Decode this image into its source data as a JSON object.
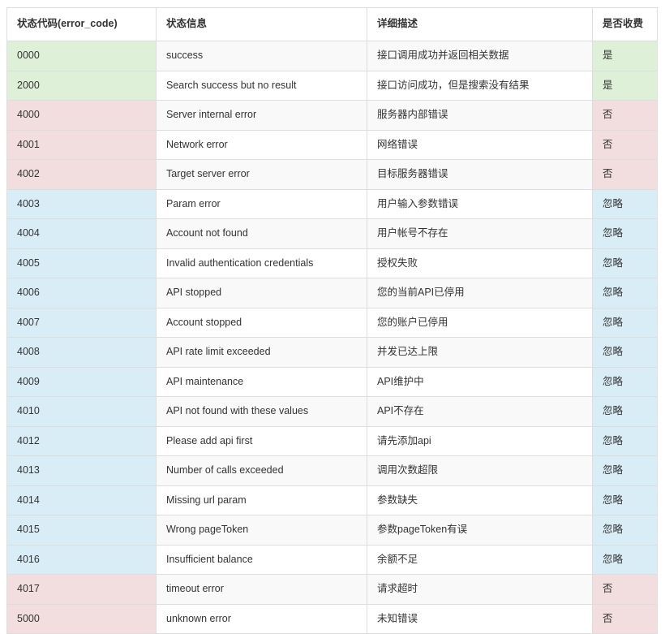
{
  "table": {
    "columns": [
      {
        "key": "code",
        "label": "状态代码(error_code)"
      },
      {
        "key": "msg",
        "label": "状态信息"
      },
      {
        "key": "desc",
        "label": "详细描述"
      },
      {
        "key": "fee",
        "label": "是否收费"
      }
    ],
    "status_colors": {
      "success": "#dff0d8",
      "error": "#f2dede",
      "ignore": "#d9edf7",
      "stripe": "#f9f9f9",
      "plain": "#ffffff",
      "border": "#dddddd"
    },
    "rows": [
      {
        "code": "0000",
        "msg": "success",
        "desc": "接口调用成功并返回相关数据",
        "fee": "是",
        "status": "success"
      },
      {
        "code": "2000",
        "msg": "Search success but no result",
        "desc": "接口访问成功，但是搜索没有结果",
        "fee": "是",
        "status": "success"
      },
      {
        "code": "4000",
        "msg": "Server internal error",
        "desc": "服务器内部错误",
        "fee": "否",
        "status": "error"
      },
      {
        "code": "4001",
        "msg": "Network error",
        "desc": "网络错误",
        "fee": "否",
        "status": "error"
      },
      {
        "code": "4002",
        "msg": "Target server error",
        "desc": "目标服务器错误",
        "fee": "否",
        "status": "error"
      },
      {
        "code": "4003",
        "msg": "Param error",
        "desc": "用户输入参数错误",
        "fee": "忽略",
        "status": "ignore"
      },
      {
        "code": "4004",
        "msg": "Account not found",
        "desc": "用户帐号不存在",
        "fee": "忽略",
        "status": "ignore"
      },
      {
        "code": "4005",
        "msg": "Invalid authentication credentials",
        "desc": "授权失败",
        "fee": "忽略",
        "status": "ignore"
      },
      {
        "code": "4006",
        "msg": "API stopped",
        "desc": "您的当前API已停用",
        "fee": "忽略",
        "status": "ignore"
      },
      {
        "code": "4007",
        "msg": "Account stopped",
        "desc": "您的账户已停用",
        "fee": "忽略",
        "status": "ignore"
      },
      {
        "code": "4008",
        "msg": "API rate limit exceeded",
        "desc": "并发已达上限",
        "fee": "忽略",
        "status": "ignore"
      },
      {
        "code": "4009",
        "msg": "API maintenance",
        "desc": "API维护中",
        "fee": "忽略",
        "status": "ignore"
      },
      {
        "code": "4010",
        "msg": "API not found with these values",
        "desc": "API不存在",
        "fee": "忽略",
        "status": "ignore"
      },
      {
        "code": "4012",
        "msg": "Please add api first",
        "desc": "请先添加api",
        "fee": "忽略",
        "status": "ignore"
      },
      {
        "code": "4013",
        "msg": "Number of calls exceeded",
        "desc": "调用次数超限",
        "fee": "忽略",
        "status": "ignore"
      },
      {
        "code": "4014",
        "msg": "Missing url param",
        "desc": "参数缺失",
        "fee": "忽略",
        "status": "ignore"
      },
      {
        "code": "4015",
        "msg": "Wrong pageToken",
        "desc": "参数pageToken有误",
        "fee": "忽略",
        "status": "ignore"
      },
      {
        "code": "4016",
        "msg": "Insufficient balance",
        "desc": "余额不足",
        "fee": "忽略",
        "status": "ignore"
      },
      {
        "code": "4017",
        "msg": "timeout error",
        "desc": "请求超时",
        "fee": "否",
        "status": "error"
      },
      {
        "code": "5000",
        "msg": "unknown error",
        "desc": "未知错误",
        "fee": "否",
        "status": "error"
      }
    ]
  }
}
